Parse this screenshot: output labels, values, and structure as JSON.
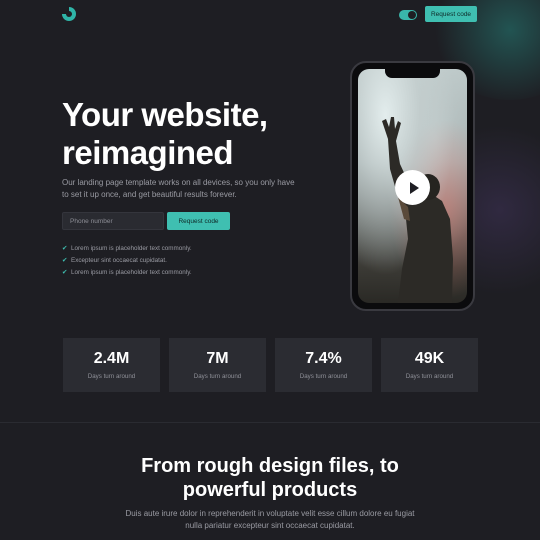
{
  "header": {
    "logo": "logo-ring-icon",
    "theme_toggle": "on",
    "cta_label": "Request code"
  },
  "hero": {
    "title_line1": "Your website,",
    "title_line2": "reimagined",
    "description": "Our landing page template works on all devices, so you only have to set it up once, and get beautiful results forever.",
    "phone_placeholder": "Phone number",
    "cta_label": "Request code",
    "checklist": [
      "Lorem ipsum is placeholder text commonly.",
      "Excepteur sint occaecat cupidatat.",
      "Lorem ipsum is placeholder text commonly."
    ],
    "check_icon": "checkmark-icon"
  },
  "phone_mockup": {
    "play_icon": "play-icon"
  },
  "stats": [
    {
      "value": "2.4M",
      "label": "Days turn around"
    },
    {
      "value": "7M",
      "label": "Days turn around"
    },
    {
      "value": "7.4%",
      "label": "Days turn around"
    },
    {
      "value": "49K",
      "label": "Days turn around"
    }
  ],
  "section": {
    "title_line1": "From rough design files, to",
    "title_line2": "powerful products",
    "desc_line1": "Duis aute irure dolor in reprehenderit in voluptate velit esse cillum dolore eu fugiat",
    "desc_line2": "nulla pariatur excepteur sint occaecat cupidatat."
  },
  "colors": {
    "background": "#1e1e23",
    "accent": "#3fbfb1",
    "card": "#2b2c32",
    "muted_text": "#9a9ba3"
  }
}
